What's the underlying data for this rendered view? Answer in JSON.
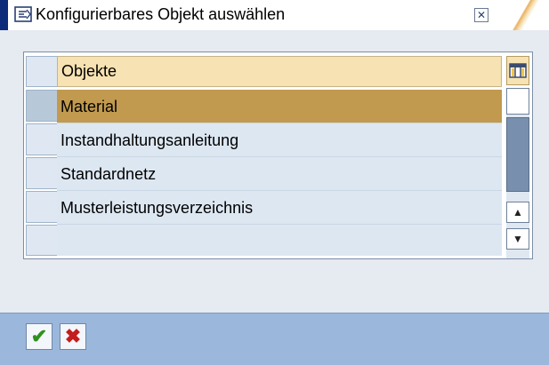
{
  "window": {
    "title": "Konfigurierbares Objekt auswählen",
    "close_icon": "close-icon"
  },
  "table": {
    "header": "Objekte",
    "rows": [
      "Material",
      "Instandhaltungsanleitung",
      "Standardnetz",
      "Musterleistungsverzeichnis",
      ""
    ],
    "selected_row_index": 0
  },
  "footer": {
    "ok_icon": "checkmark-icon",
    "cancel_icon": "cancel-x-icon"
  },
  "colors": {
    "header_bg": "#f6e2b2",
    "selected_row_bg": "#c19a4f",
    "row_bg": "#dde7f2",
    "footer_bg": "#9bb8dc",
    "title_accent": "#0c2a7a"
  }
}
